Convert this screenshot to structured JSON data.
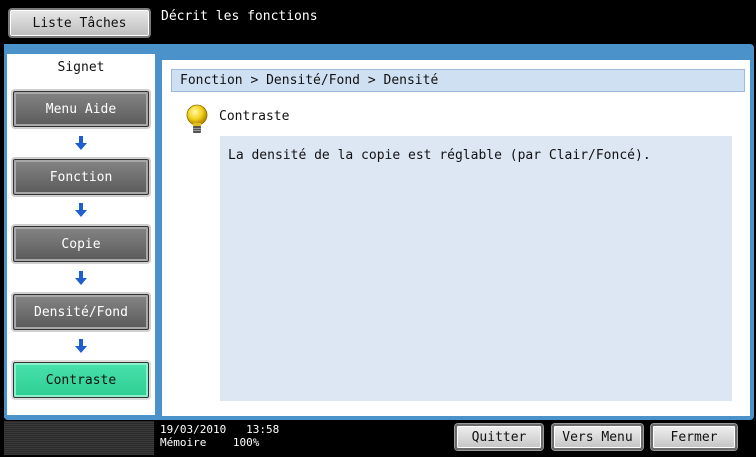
{
  "header": {
    "task_list_button": "Liste Tâches",
    "title": "Décrit les fonctions"
  },
  "sidebar": {
    "label": "Signet",
    "items": [
      {
        "label": "Menu Aide",
        "active": false
      },
      {
        "label": "Fonction",
        "active": false
      },
      {
        "label": "Copie",
        "active": false
      },
      {
        "label": "Densité/Fond",
        "active": false
      },
      {
        "label": "Contraste",
        "active": true
      }
    ]
  },
  "main": {
    "breadcrumb": "Fonction > Densité/Fond > Densité",
    "topic_title": "Contraste",
    "description": "La densité de la copie est réglable (par Clair/Foncé)."
  },
  "status": {
    "date": "19/03/2010",
    "time": "13:58",
    "memory_label": "Mémoire",
    "memory_value": "100%"
  },
  "footer": {
    "quit_label": "Quitter",
    "menu_label": "Vers Menu",
    "close_label": "Fermer"
  },
  "colors": {
    "frame": "#4a92c9",
    "active_item": "#2ccd93",
    "nav_item": "#666666",
    "breadcrumb_bg": "#cfe0f3",
    "description_bg": "#dde7f4"
  },
  "icons": {
    "help": "lightbulb-icon",
    "step": "arrow-down-icon"
  }
}
